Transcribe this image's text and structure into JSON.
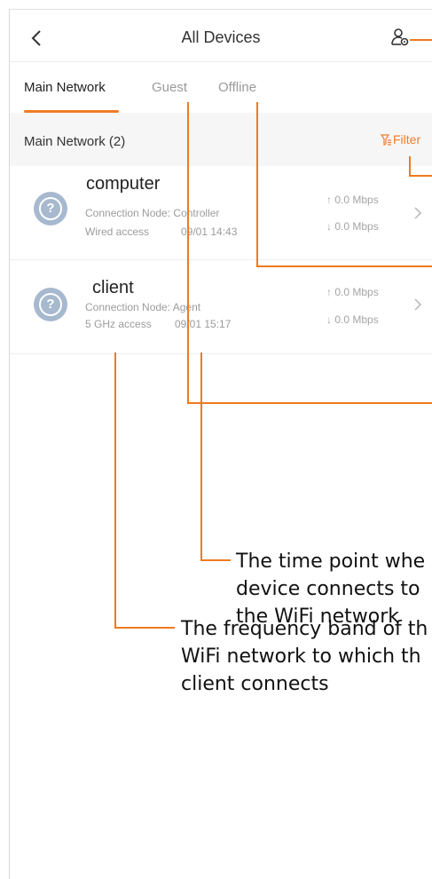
{
  "header": {
    "title": "All Devices",
    "back_icon": "chevron-left-icon",
    "user_icon": "user-settings-icon"
  },
  "tabs": [
    {
      "label": "Main Network",
      "active": true
    },
    {
      "label": "Guest",
      "active": false
    },
    {
      "label": "Offline",
      "active": false
    }
  ],
  "section": {
    "title": "Main Network (2)",
    "filter_label": "Filter",
    "filter_icon": "filter-icon"
  },
  "devices": [
    {
      "name": "computer",
      "node": "Connection Node: Controller",
      "access": "Wired access",
      "time": "09/01 14:43",
      "upload": "↑ 0.0 Mbps",
      "download": "↓ 0.0 Mbps",
      "icon": "unknown-device-icon"
    },
    {
      "name": "client",
      "node": "Connection Node: Agent",
      "access": "5 GHz access",
      "time": "09/01 15:17",
      "upload": "↑ 0.0 Mbps",
      "download": "↓ 0.0 Mbps",
      "icon": "unknown-device-icon"
    }
  ],
  "annotations": {
    "time_line1": "The time point whe",
    "time_line2": "device connects to",
    "time_line3": "the WiFi network",
    "band_line1": "The frequency band of th",
    "band_line2": "WiFi network to which th",
    "band_line3": "client connects"
  },
  "colors": {
    "accent": "#ee7c2b",
    "device_icon": "#a7b9cf",
    "section_bg": "#f6f6f6"
  }
}
